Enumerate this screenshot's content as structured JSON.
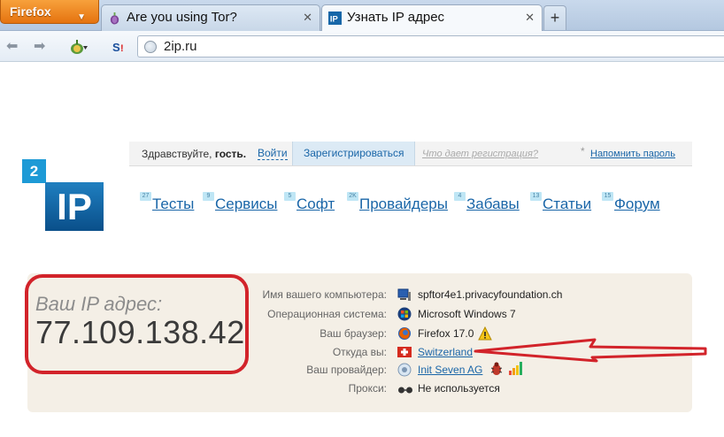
{
  "browser": {
    "menu_button": "Firefox",
    "tabs": [
      {
        "title": "Are you using Tor?",
        "active": false
      },
      {
        "title": "Узнать IP адрес",
        "active": true
      }
    ],
    "new_tab_label": "+",
    "address": "2ip.ru"
  },
  "site": {
    "logo_small": "2",
    "logo_big": "IP",
    "header": {
      "greeting_prefix": "Здравствуйте, ",
      "greeting_user": "гость.",
      "login": "Войти",
      "register": "Зарегистрироваться",
      "what_gives": "Что дает регистрация?",
      "star": "*",
      "remind": "Напомнить пароль"
    },
    "menu": [
      {
        "label": "Тесты",
        "count": "27"
      },
      {
        "label": "Сервисы",
        "count": "9"
      },
      {
        "label": "Софт",
        "count": "5"
      },
      {
        "label": "Провайдеры",
        "count": "2K"
      },
      {
        "label": "Забавы",
        "count": "4"
      },
      {
        "label": "Статьи",
        "count": "13"
      },
      {
        "label": "Форум",
        "count": "15"
      }
    ],
    "ip": {
      "caption": "Ваш IP адрес:",
      "value": "77.109.138.42"
    },
    "info_rows": [
      {
        "label": "Имя вашего компьютера:",
        "value": "spftor4e1.privacyfoundation.ch",
        "icon": "computer-icon",
        "link": false
      },
      {
        "label": "Операционная система:",
        "value": "Microsoft Windows 7",
        "icon": "windows-icon",
        "link": false
      },
      {
        "label": "Ваш браузер:",
        "value": "Firefox 17.0",
        "icon": "firefox-icon",
        "link": false
      },
      {
        "label": "Откуда вы:",
        "value": "Switzerland",
        "icon": "swiss-flag-icon",
        "link": true
      },
      {
        "label": "Ваш провайдер:",
        "value": "Init Seven AG",
        "icon": "provider-icon",
        "link": true
      },
      {
        "label": "Прокси:",
        "value": "Не используется",
        "icon": "glasses-icon",
        "link": false
      }
    ]
  },
  "colors": {
    "accent_blue": "#1a66a8",
    "highlight_red": "#d2232a",
    "firefox_orange": "#e5730f",
    "panel_bg": "#f4efe6"
  }
}
